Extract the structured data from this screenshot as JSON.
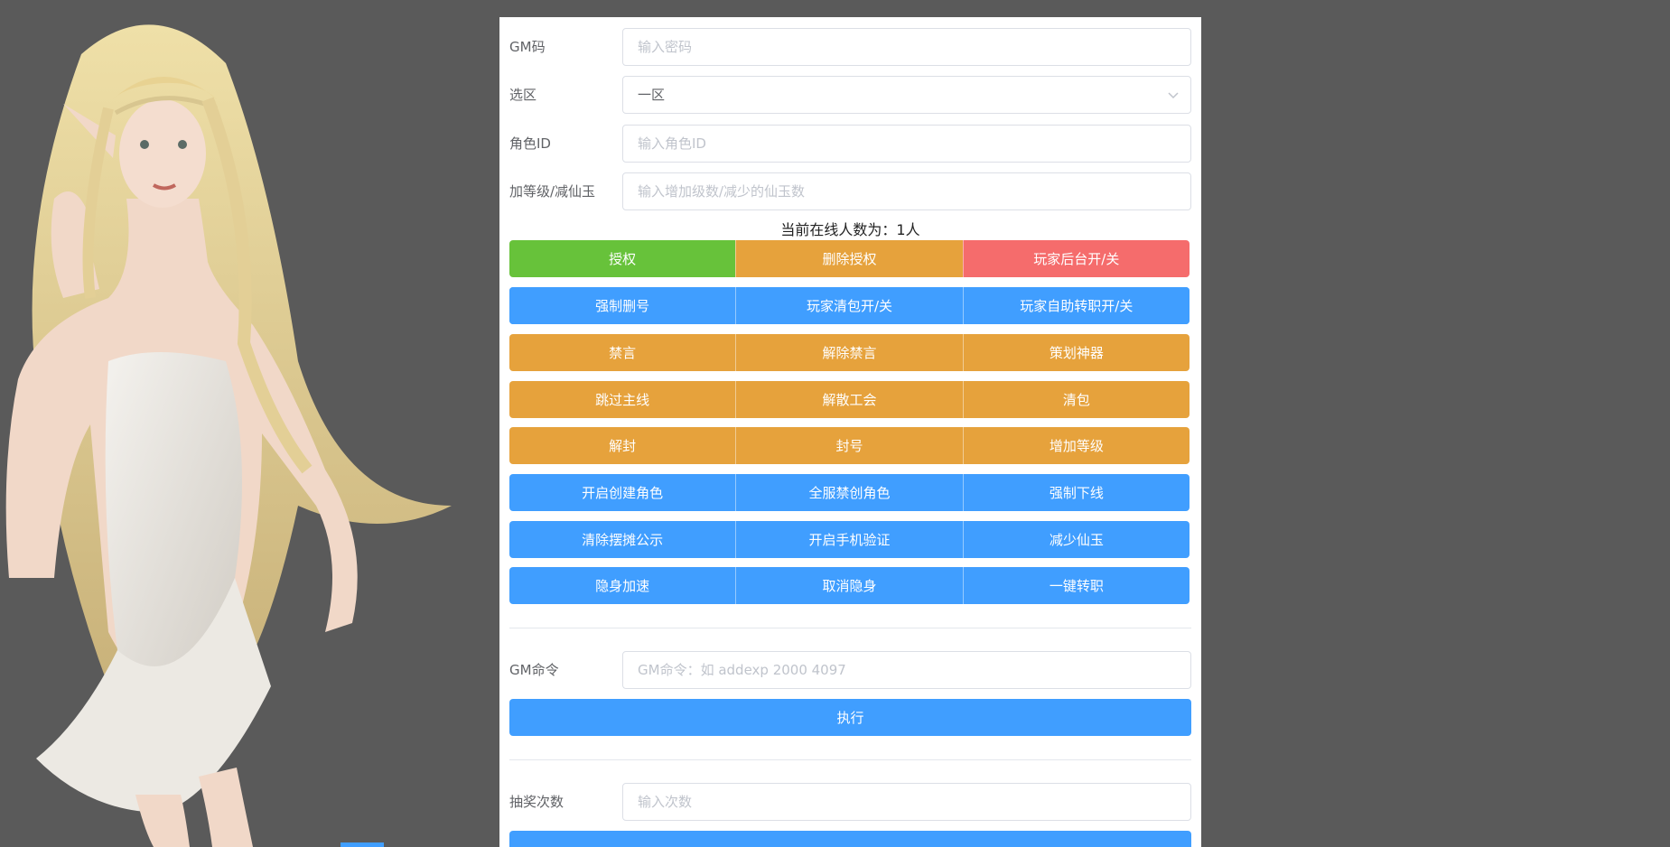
{
  "form": {
    "gm_code": {
      "label": "GM码",
      "placeholder": "输入密码"
    },
    "zone": {
      "label": "选区",
      "value": "一区"
    },
    "role_id": {
      "label": "角色ID",
      "placeholder": "输入角色ID"
    },
    "level_jade": {
      "label": "加等级/减仙玉",
      "placeholder": "输入增加级数/减少的仙玉数"
    }
  },
  "online": {
    "text": "当前在线人数为：1人"
  },
  "button_groups": [
    {
      "color": "mixed",
      "buttons": [
        "授权",
        "删除授权",
        "玩家后台开/关"
      ]
    },
    {
      "color": "blue",
      "buttons": [
        "强制删号",
        "玩家清包开/关",
        "玩家自助转职开/关"
      ]
    },
    {
      "color": "orange",
      "buttons": [
        "禁言",
        "解除禁言",
        "策划神器"
      ]
    },
    {
      "color": "orange",
      "buttons": [
        "跳过主线",
        "解散工会",
        "清包"
      ]
    },
    {
      "color": "orange",
      "buttons": [
        "解封",
        "封号",
        "增加等级"
      ]
    },
    {
      "color": "blue",
      "buttons": [
        "开启创建角色",
        "全服禁创角色",
        "强制下线"
      ]
    },
    {
      "color": "blue",
      "buttons": [
        "清除摆摊公示",
        "开启手机验证",
        "减少仙玉"
      ]
    },
    {
      "color": "blue",
      "buttons": [
        "隐身加速",
        "取消隐身",
        "一键转职"
      ]
    }
  ],
  "gm_command": {
    "label": "GM命令",
    "placeholder": "GM命令：如 addexp 2000 4097",
    "execute_label": "执行"
  },
  "lottery": {
    "label": "抽奖次数",
    "placeholder": "输入次数"
  },
  "colors": {
    "blue": "#409eff",
    "orange": "#e6a23c",
    "green": "#67c23a",
    "red": "#f56c6c",
    "background": "#5a5a5a"
  },
  "icons": {
    "select_arrow": "chevron-down-icon"
  }
}
